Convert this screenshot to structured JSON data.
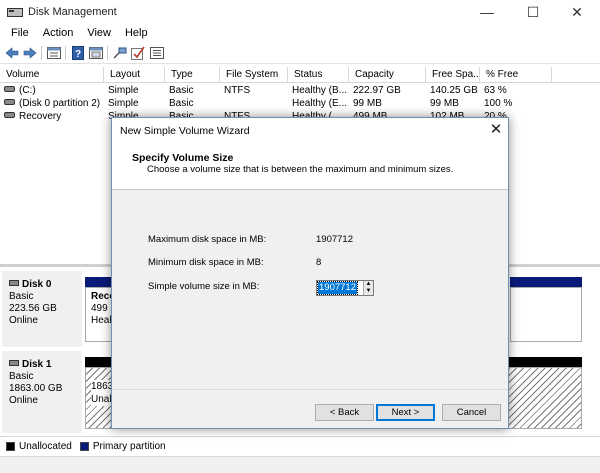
{
  "window": {
    "title": "Disk Management"
  },
  "menu": [
    "File",
    "Action",
    "View",
    "Help"
  ],
  "toolbar_icons": [
    "back-arrow-icon",
    "forward-arrow-icon",
    "disk-list-icon",
    "help-icon",
    "properties-icon",
    "connect-icon",
    "check-icon",
    "settings-list-icon"
  ],
  "volumes": {
    "columns": [
      "Volume",
      "Layout",
      "Type",
      "File System",
      "Status",
      "Capacity",
      "Free Spa...",
      "% Free"
    ],
    "rows": [
      {
        "volume": "(C:)",
        "layout": "Simple",
        "type": "Basic",
        "fs": "NTFS",
        "status": "Healthy (B...",
        "capacity": "222.97 GB",
        "free": "140.25 GB",
        "pct": "63 %"
      },
      {
        "volume": "(Disk 0 partition 2)",
        "layout": "Simple",
        "type": "Basic",
        "fs": "",
        "status": "Healthy (E...",
        "capacity": "99 MB",
        "free": "99 MB",
        "pct": "100 %"
      },
      {
        "volume": "Recovery",
        "layout": "Simple",
        "type": "Basic",
        "fs": "NTFS",
        "status": "Healthy (...",
        "capacity": "499 MB",
        "free": "102 MB",
        "pct": "20 %"
      }
    ]
  },
  "disks": [
    {
      "name": "Disk 0",
      "kind": "Basic",
      "size": "223.56 GB",
      "state": "Online",
      "partition_title": "Reco",
      "partition_size": "499 N",
      "partition_status": "Healt"
    },
    {
      "name": "Disk 1",
      "kind": "Basic",
      "size": "1863.00 GB",
      "state": "Online",
      "partition_size": "1863.",
      "partition_status": "Unall"
    }
  ],
  "legend": {
    "unallocated": "Unallocated",
    "primary": "Primary partition",
    "unallocated_color": "#000000",
    "primary_color": "#0a1a78"
  },
  "dialog": {
    "title": "New Simple Volume Wizard",
    "heading": "Specify Volume Size",
    "subheading": "Choose a volume size that is between the maximum and minimum sizes.",
    "max_label": "Maximum disk space in MB:",
    "max_value": "1907712",
    "min_label": "Minimum disk space in MB:",
    "min_value": "8",
    "size_label": "Simple volume size in MB:",
    "size_value": "1907712",
    "back": "< Back",
    "next": "Next >",
    "cancel": "Cancel"
  }
}
